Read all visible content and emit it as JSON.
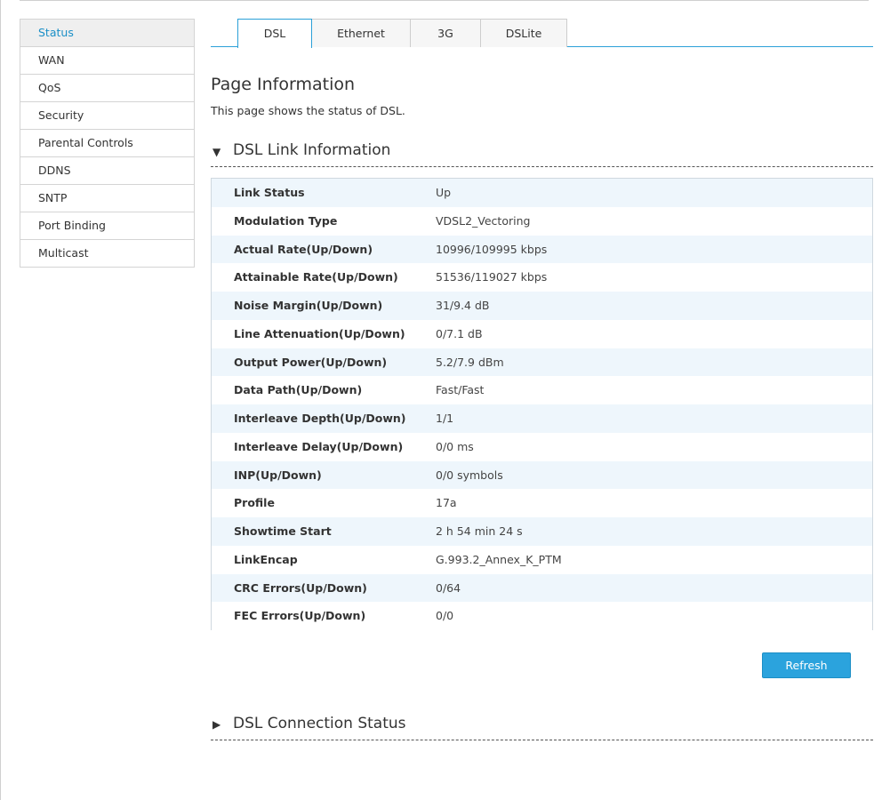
{
  "sidebar": {
    "items": [
      {
        "label": "Status",
        "active": true
      },
      {
        "label": "WAN"
      },
      {
        "label": "QoS"
      },
      {
        "label": "Security"
      },
      {
        "label": "Parental Controls"
      },
      {
        "label": "DDNS"
      },
      {
        "label": "SNTP"
      },
      {
        "label": "Port Binding"
      },
      {
        "label": "Multicast"
      }
    ]
  },
  "tabs": [
    {
      "label": "DSL",
      "active": true
    },
    {
      "label": "Ethernet"
    },
    {
      "label": "3G"
    },
    {
      "label": "DSLite"
    }
  ],
  "page": {
    "title": "Page Information",
    "description": "This page shows the status of DSL."
  },
  "link_section": {
    "title": "DSL Link Information",
    "expanded_icon": "triangle-down-icon",
    "rows": [
      {
        "label": "Link Status",
        "value": "Up"
      },
      {
        "label": "Modulation Type",
        "value": "VDSL2_Vectoring"
      },
      {
        "label": "Actual Rate(Up/Down)",
        "value": "10996/109995 kbps"
      },
      {
        "label": "Attainable Rate(Up/Down)",
        "value": "51536/119027 kbps"
      },
      {
        "label": "Noise Margin(Up/Down)",
        "value": "31/9.4 dB"
      },
      {
        "label": "Line Attenuation(Up/Down)",
        "value": "0/7.1 dB"
      },
      {
        "label": "Output Power(Up/Down)",
        "value": "5.2/7.9 dBm"
      },
      {
        "label": "Data Path(Up/Down)",
        "value": "Fast/Fast"
      },
      {
        "label": "Interleave Depth(Up/Down)",
        "value": "1/1"
      },
      {
        "label": "Interleave Delay(Up/Down)",
        "value": "0/0 ms"
      },
      {
        "label": "INP(Up/Down)",
        "value": "0/0 symbols"
      },
      {
        "label": "Profile",
        "value": "17a"
      },
      {
        "label": "Showtime Start",
        "value": "2 h 54 min 24 s"
      },
      {
        "label": "LinkEncap",
        "value": "G.993.2_Annex_K_PTM"
      },
      {
        "label": "CRC Errors(Up/Down)",
        "value": "0/64"
      },
      {
        "label": "FEC Errors(Up/Down)",
        "value": "0/0"
      }
    ]
  },
  "refresh_label": "Refresh",
  "connection_section": {
    "title": "DSL Connection Status",
    "collapsed_icon": "triangle-right-icon"
  },
  "colors": {
    "accent": "#2ba3dd",
    "row_alt": "#eef6fc",
    "active_link": "#1a8fc7"
  }
}
